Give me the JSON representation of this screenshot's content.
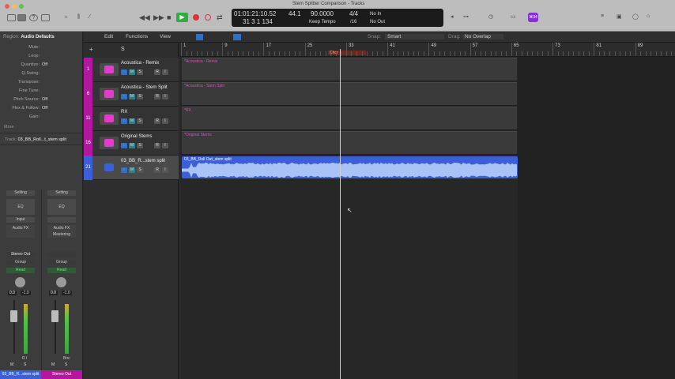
{
  "window": {
    "title": "Stem Splitter Comparison - Tracks"
  },
  "lcd": {
    "time": "01:01:21:10.52",
    "bars": "31  3  1  134",
    "sample_rate": "44.1",
    "tempo": "90.0000",
    "tempo_mode": "Keep Tempo",
    "signature": "4/4",
    "division": "/16",
    "in": "No In",
    "out": "No Out"
  },
  "toolbar": {
    "badge": "⌘34"
  },
  "inspector": {
    "region_label": "Region:",
    "region_value": "Audio Defaults",
    "rows": [
      {
        "k": "Mute:",
        "v": ""
      },
      {
        "k": "Loop:",
        "v": ""
      },
      {
        "k": "Quantize:",
        "v": "Off"
      },
      {
        "k": "Q-Swing:",
        "v": ""
      },
      {
        "k": "Transpose:",
        "v": ""
      },
      {
        "k": "Fine Tune:",
        "v": ""
      },
      {
        "k": "Pitch Source:",
        "v": "Off"
      },
      {
        "k": "Flex & Follow:",
        "v": "Off"
      },
      {
        "k": "Gain:",
        "v": ""
      }
    ],
    "more": "More",
    "track_label": "Track:",
    "track_value": "03_BB_Roll...t_stem split"
  },
  "menus": {
    "edit": "Edit",
    "functions": "Functions",
    "view": "View",
    "snap_label": "Snap:",
    "snap": "Smart",
    "drag_label": "Drag:",
    "drag": "No Overlap",
    "s_button": "S"
  },
  "ruler": {
    "bars": [
      "1",
      "9",
      "17",
      "25",
      "33",
      "41",
      "49",
      "57",
      "65",
      "73",
      "81",
      "89"
    ],
    "marker": "Chor"
  },
  "tracks": [
    {
      "num": "1",
      "name": "Acoustica - Remix",
      "region": "*Acoustica - Remix",
      "color": "#b3179f"
    },
    {
      "num": "6",
      "name": "Acoustica - Stem Split",
      "region": "*Acoustica - Stem Split",
      "color": "#b3179f"
    },
    {
      "num": "11",
      "name": "RX",
      "region": "*RX",
      "color": "#b3179f"
    },
    {
      "num": "16",
      "name": "Original Stems",
      "region": "*Original Stems",
      "color": "#b3179f"
    },
    {
      "num": "21",
      "name": "03_BB_R...stem split",
      "region": "03_BB_Roll Out_stem split",
      "color": "#3b5fd6"
    }
  ],
  "track_buttons": {
    "m": "M",
    "s": "S",
    "r": "R",
    "i": "I"
  },
  "mixer": [
    {
      "setting": "Setting",
      "eq": "EQ",
      "input": "Input",
      "fx": "Audio FX",
      "send": "",
      "output": "Stereo Out",
      "group": "Group",
      "auto": "Read",
      "vol": "0.0",
      "peak": "-1.0",
      "m": "M",
      "s": "S",
      "ri": "R  I",
      "name": "03_BB_R...stem split",
      "color": "#3b5fd6"
    },
    {
      "setting": "Setting",
      "eq": "EQ",
      "input": "",
      "fx": "Audio FX Mastering",
      "send": "",
      "output": "",
      "group": "Group",
      "auto": "Read",
      "vol": "0.0",
      "peak": "-1.0",
      "m": "M",
      "s": "S",
      "ri": "Bnc",
      "name": "Stereo Out",
      "color": "#b3179f"
    }
  ]
}
